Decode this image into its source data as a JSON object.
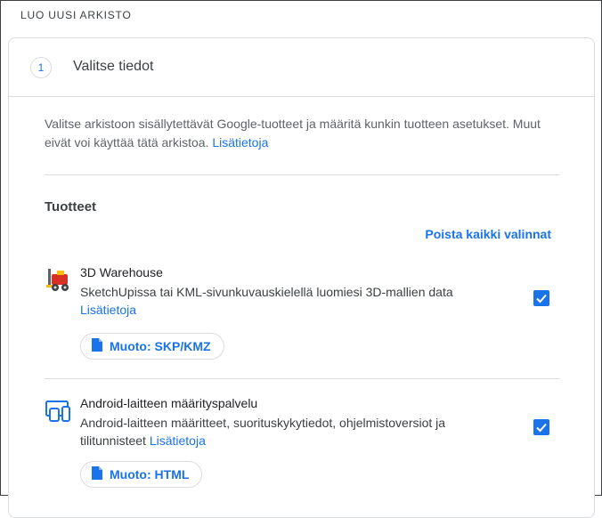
{
  "page": {
    "heading": "LUO UUSI ARKISTO"
  },
  "step": {
    "number": "1",
    "title": "Valitse tiedot"
  },
  "intro": {
    "text": "Valitse arkistoon sisällytettävät Google-tuotteet ja määritä kunkin tuotteen asetukset. Muut eivät voi käyttää tätä arkistoa.",
    "link": "Lisätietoja"
  },
  "products_section": {
    "title": "Tuotteet",
    "deselect_all": "Poista kaikki valinnat",
    "items": [
      {
        "name": "3D Warehouse",
        "description": "SketchUpissa tai KML-sivunkuvauskielellä luomiesi 3D-mallien data",
        "link": "Lisätietoja",
        "checked": true,
        "format_label": "Muoto: SKP/KMZ",
        "icon": "3d-warehouse-icon"
      },
      {
        "name": "Android-laitteen määrityspalvelu",
        "description": "Android-laitteen määritteet, suorituskykytiedot, ohjelmistoversiot ja tilitunnisteet",
        "link": "Lisätietoja",
        "checked": true,
        "format_label": "Muoto: HTML",
        "icon": "android-devices-icon"
      }
    ]
  },
  "colors": {
    "accent": "#1a73e8",
    "divider": "#dadce0",
    "text": "#202124"
  }
}
